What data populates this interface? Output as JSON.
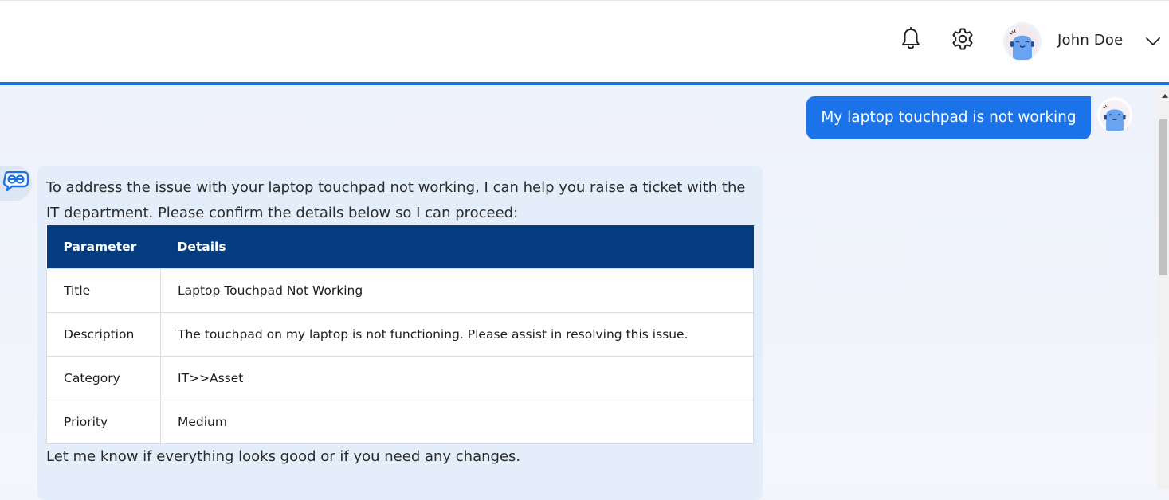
{
  "header": {
    "user_name": "John Doe",
    "icons": [
      "bell-icon",
      "gear-icon",
      "chevron-down-icon"
    ],
    "accent_color": "#1a73e8"
  },
  "chat": {
    "user_message": "My laptop touchpad is not working",
    "bot_intro": "To address the issue with your laptop touchpad not working, I can help you raise a ticket with the IT department. Please confirm the details below so I can proceed:",
    "ticket_table": {
      "headers": [
        "Parameter",
        "Details"
      ],
      "rows": [
        [
          "Title",
          "Laptop Touchpad Not Working"
        ],
        [
          "Description",
          "The touchpad on my laptop is not functioning. Please assist in resolving this issue."
        ],
        [
          "Category",
          "IT>>Asset"
        ],
        [
          "Priority",
          "Medium"
        ]
      ]
    },
    "bot_outro": "Let me know if everything looks good or if you need any changes."
  },
  "colors": {
    "table_header": "#043c80",
    "user_bubble": "#1a73e8",
    "bot_card": "#e4eefb"
  }
}
